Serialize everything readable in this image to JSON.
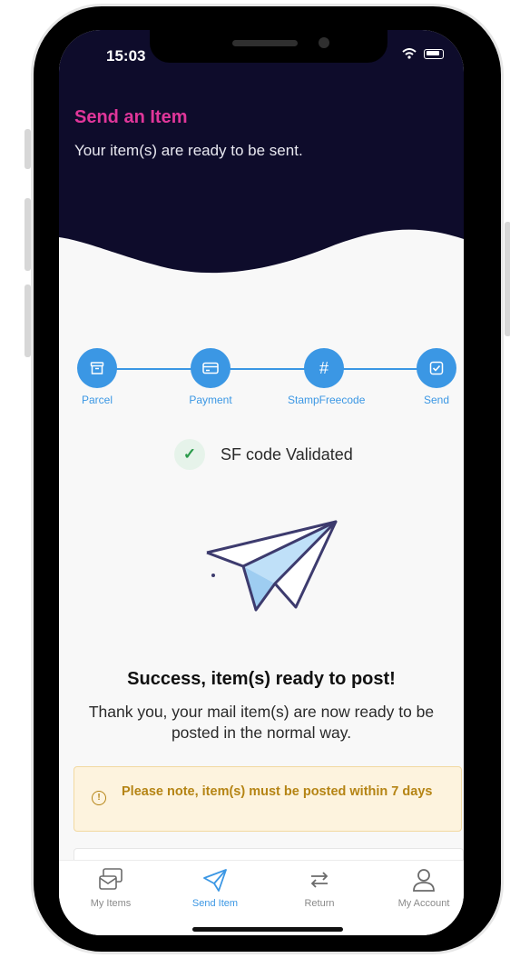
{
  "status_bar": {
    "time": "15:03"
  },
  "header": {
    "title": "Send an Item",
    "subtitle": "Your item(s) are ready to be sent."
  },
  "stepper": {
    "steps": [
      {
        "label": "Parcel",
        "icon": "archive-icon"
      },
      {
        "label": "Payment",
        "icon": "card-icon"
      },
      {
        "label": "StampFreecode",
        "icon": "hash-icon",
        "symbol": "#"
      },
      {
        "label": "Send",
        "icon": "check-square-icon"
      }
    ]
  },
  "validation": {
    "text": "SF code Validated"
  },
  "success": {
    "title": "Success, item(s) ready to post!",
    "body": "Thank you, your mail item(s) are now ready to be posted in the normal way."
  },
  "notice": {
    "text": "Please note, item(s) must be posted within 7 days"
  },
  "tabbar": {
    "items": [
      {
        "label": "My Items",
        "icon": "mail-stack-icon",
        "active": false
      },
      {
        "label": "Send Item",
        "icon": "paper-plane-icon",
        "active": true
      },
      {
        "label": "Return",
        "icon": "return-arrows-icon",
        "active": false
      },
      {
        "label": "My Account",
        "icon": "user-icon",
        "active": false
      }
    ]
  },
  "colors": {
    "header_bg": "#0e0c2b",
    "accent_pink": "#e0369a",
    "primary_blue": "#3b97e4",
    "notice_text": "#b58414",
    "notice_bg": "#fdf3de"
  }
}
